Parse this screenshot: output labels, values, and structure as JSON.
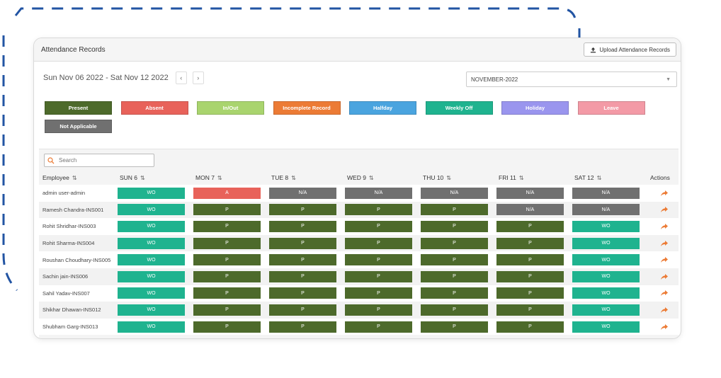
{
  "header": {
    "title": "Attendance Records",
    "upload_label": "Upload Attendance Records"
  },
  "date_range": {
    "text": "Sun Nov 06 2022 - Sat Nov 12 2022",
    "prev_label": "‹",
    "next_label": "›"
  },
  "month_select": {
    "value": "NOVEMBER-2022"
  },
  "legend": [
    {
      "label": "Present",
      "color": "#4d6a2b"
    },
    {
      "label": "Absent",
      "color": "#e8625a"
    },
    {
      "label": "In/Out",
      "color": "#a9d46e"
    },
    {
      "label": "Incomplete Record",
      "color": "#ec7b35"
    },
    {
      "label": "Halfday",
      "color": "#4aa4df"
    },
    {
      "label": "Weekly Off",
      "color": "#1fb38f"
    },
    {
      "label": "Holiday",
      "color": "#9a95ee"
    },
    {
      "label": "Leave",
      "color": "#f39aa6"
    },
    {
      "label": "Not Applicable",
      "color": "#707070"
    }
  ],
  "status_colors": {
    "WO": "#1fb38f",
    "A": "#e8625a",
    "N/A": "#707070",
    "P": "#4d6a2b"
  },
  "search": {
    "placeholder": "Search"
  },
  "table": {
    "sort_icon": "⇅",
    "columns": [
      "Employee",
      "SUN 6",
      "MON 7",
      "TUE 8",
      "WED 9",
      "THU 10",
      "FRI 11",
      "SAT 12",
      "Actions"
    ],
    "rows": [
      {
        "name": "admin user-admin",
        "days": [
          "WO",
          "A",
          "N/A",
          "N/A",
          "N/A",
          "N/A",
          "N/A"
        ]
      },
      {
        "name": "Ramesh Chandra-INS001",
        "days": [
          "WO",
          "P",
          "P",
          "P",
          "P",
          "N/A",
          "N/A"
        ]
      },
      {
        "name": "Rohit Shridhar-INS003",
        "days": [
          "WO",
          "P",
          "P",
          "P",
          "P",
          "P",
          "WO"
        ]
      },
      {
        "name": "Rohit Sharma-INS004",
        "days": [
          "WO",
          "P",
          "P",
          "P",
          "P",
          "P",
          "WO"
        ]
      },
      {
        "name": "Roushan Choudhary-INS005",
        "days": [
          "WO",
          "P",
          "P",
          "P",
          "P",
          "P",
          "WO"
        ]
      },
      {
        "name": "Sachin jain-INS006",
        "days": [
          "WO",
          "P",
          "P",
          "P",
          "P",
          "P",
          "WO"
        ]
      },
      {
        "name": "Sahil Yadav-INS007",
        "days": [
          "WO",
          "P",
          "P",
          "P",
          "P",
          "P",
          "WO"
        ]
      },
      {
        "name": "Shikhar Dhawan-INS012",
        "days": [
          "WO",
          "P",
          "P",
          "P",
          "P",
          "P",
          "WO"
        ]
      },
      {
        "name": "Shubham Garg-INS013",
        "days": [
          "WO",
          "P",
          "P",
          "P",
          "P",
          "P",
          "WO"
        ]
      }
    ]
  }
}
